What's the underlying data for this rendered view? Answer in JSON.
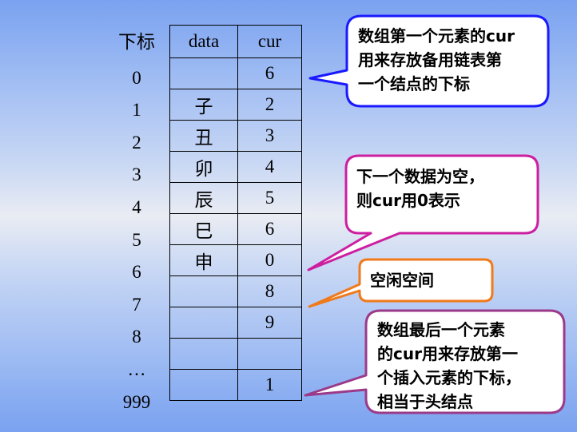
{
  "table": {
    "header": {
      "index": "下标",
      "data": "data",
      "cur": "cur"
    },
    "rows": [
      {
        "index": "0",
        "data": "",
        "cur": "6"
      },
      {
        "index": "1",
        "data": "子",
        "cur": "2"
      },
      {
        "index": "2",
        "data": "丑",
        "cur": "3"
      },
      {
        "index": "3",
        "data": "卯",
        "cur": "4"
      },
      {
        "index": "4",
        "data": "辰",
        "cur": "5"
      },
      {
        "index": "5",
        "data": "巳",
        "cur": "6"
      },
      {
        "index": "6",
        "data": "申",
        "cur": "0"
      },
      {
        "index": "7",
        "data": "",
        "cur": "8"
      },
      {
        "index": "8",
        "data": "",
        "cur": "9"
      },
      {
        "index": "…",
        "data": "",
        "cur": ""
      },
      {
        "index": "999",
        "data": "",
        "cur": "1"
      }
    ]
  },
  "callouts": {
    "first": {
      "lines": [
        "数组第一个元素的cur",
        "用来存放备用链表第",
        "一个结点的下标"
      ],
      "border_color": "#1a1aff"
    },
    "null": {
      "lines": [
        "下一个数据为空，",
        "则cur用0表示"
      ],
      "border_color": "#cc1fa0"
    },
    "free": {
      "lines": [
        "空闲空间"
      ],
      "border_color": "#f07a1a"
    },
    "last": {
      "lines": [
        "数组最后一个元素",
        "的cur用来存放第一",
        "个插入元素的下标，",
        "相当于头结点"
      ],
      "border_color": "#9c3a8a"
    }
  }
}
